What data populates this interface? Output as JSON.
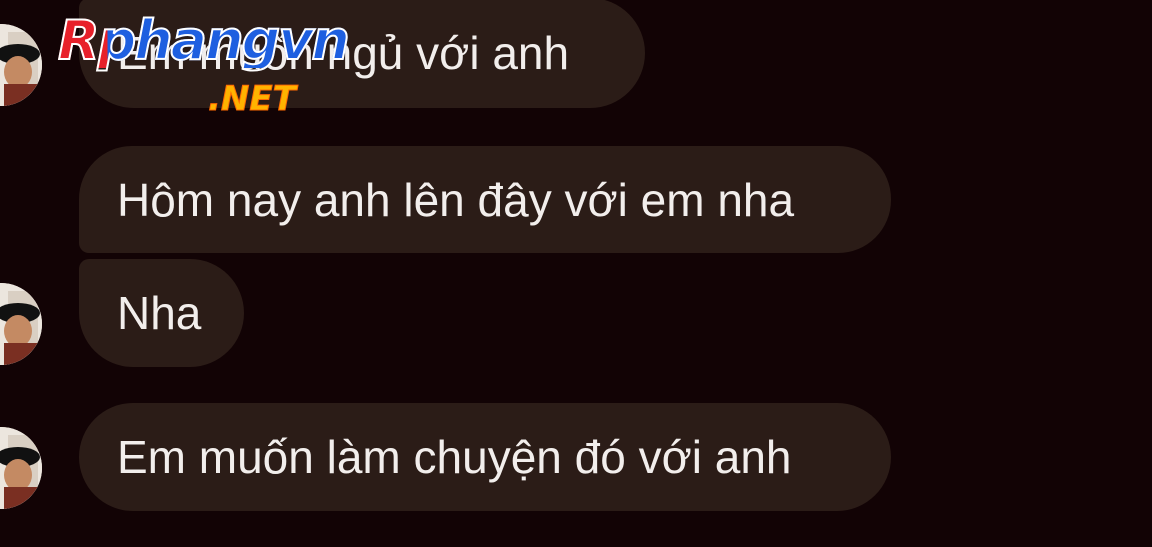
{
  "messages": [
    {
      "text": "Em muốn ngủ với anh"
    },
    {
      "text": "Hôm nay anh lên đây với em nha"
    },
    {
      "text": "Nha"
    },
    {
      "text": "Em muốn làm chuyện đó với anh"
    }
  ],
  "watermark": {
    "main": "Rphangvn",
    "suffix": ".NET"
  },
  "colors": {
    "background": "#120305",
    "bubble": "#2b1c17",
    "text": "#f2eeec",
    "watermark_red": "#e8202a",
    "watermark_blue": "#1e5fe0",
    "watermark_orange": "#ffb300"
  },
  "icons": [
    "avatar-image"
  ]
}
